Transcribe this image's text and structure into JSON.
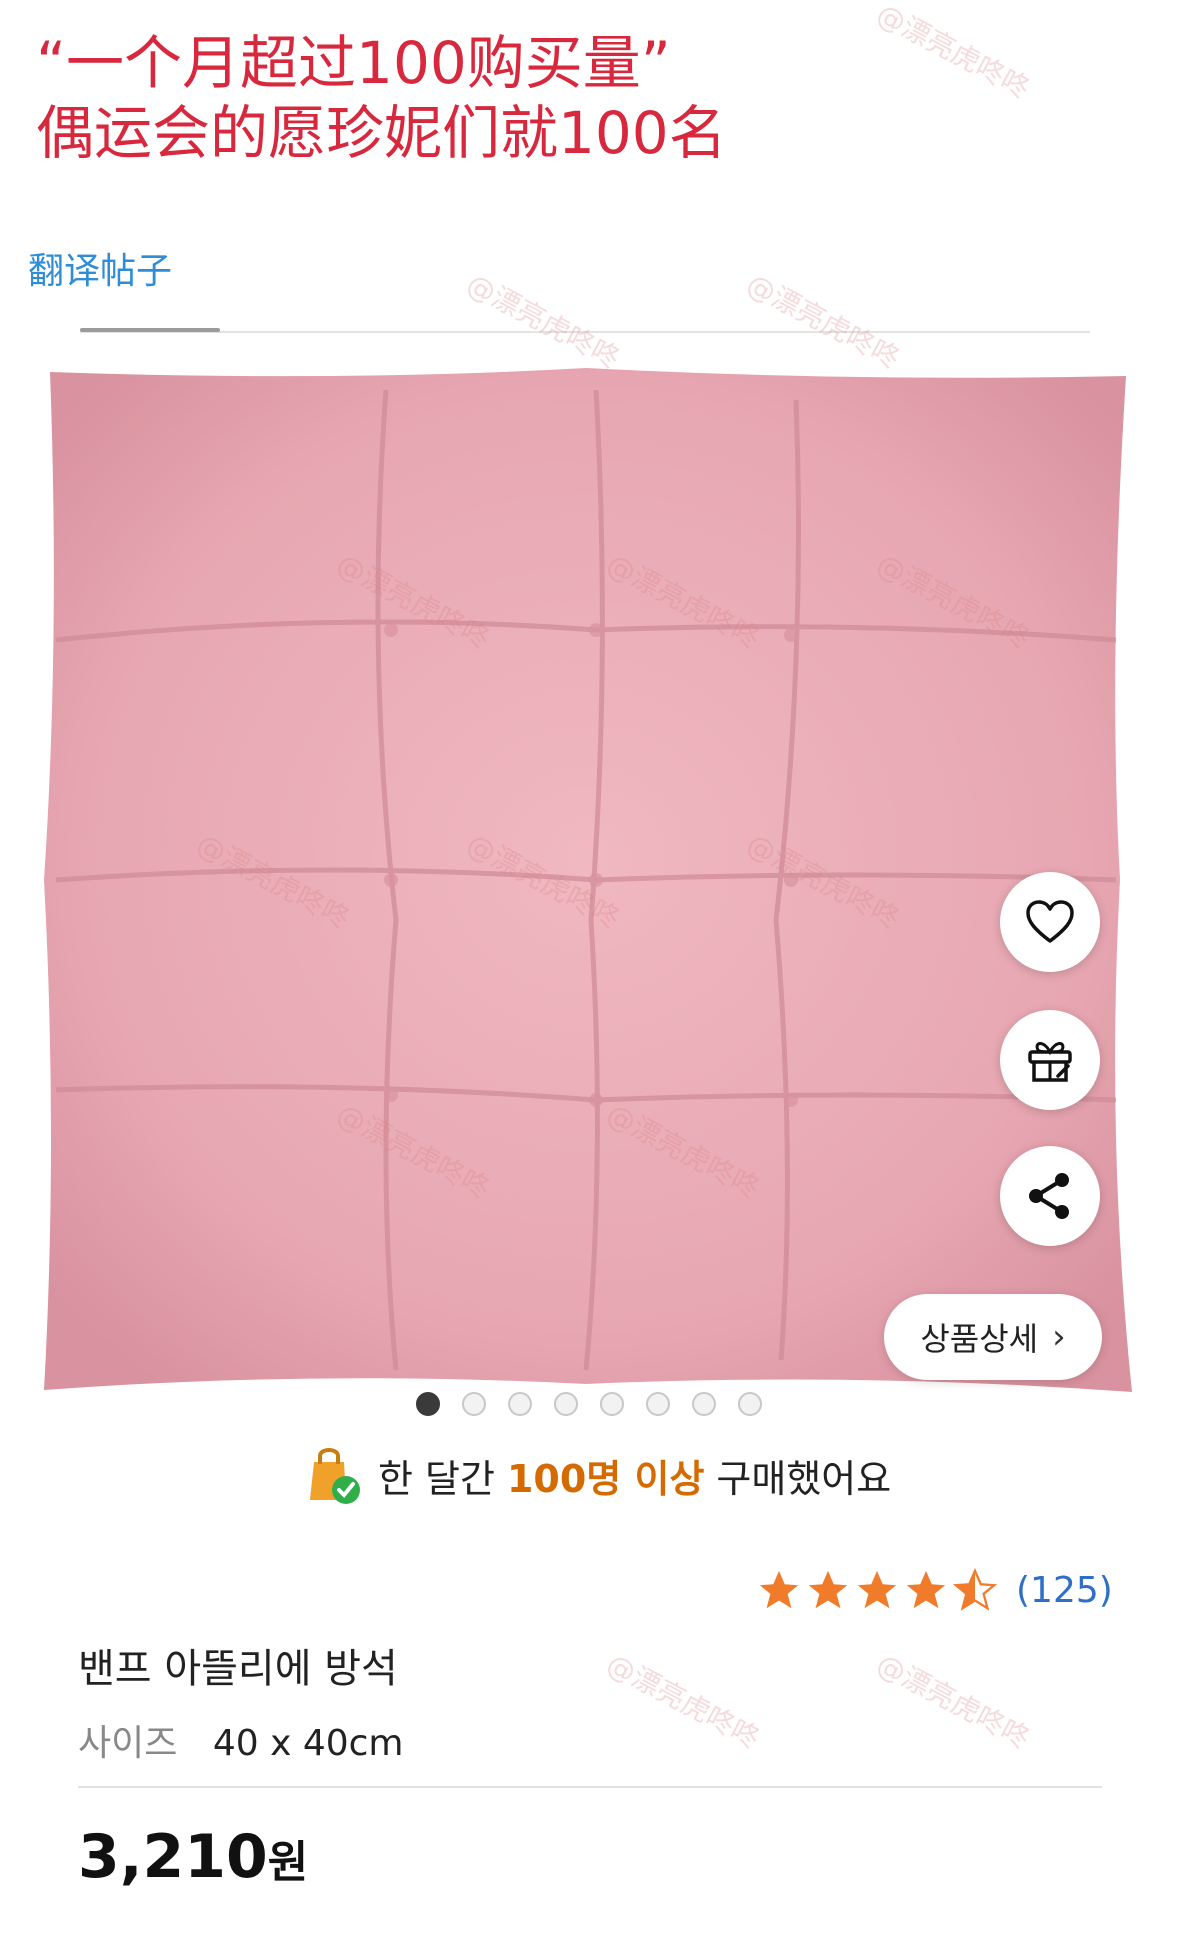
{
  "headline": {
    "line1": "“一个月超过100购买量”",
    "line2": "偶运会的愿珍妮们就100名"
  },
  "translate_link": "翻译帖子",
  "product_image": {
    "description_icon": "pink-seat-cushion",
    "dominant_color": "#e9aab5",
    "page_count": 8,
    "active_page": 1
  },
  "actions": {
    "wish_icon": "heart-icon",
    "gift_icon": "gift-icon",
    "share_icon": "share-icon",
    "detail_label": "상품상세",
    "detail_chevron": "›"
  },
  "purchase_banner": {
    "prefix": "한 달간",
    "highlight": "100명 이상",
    "suffix": "구매했어요",
    "highlight_color": "#d46a00"
  },
  "rating": {
    "stars": 4.5,
    "count_label": "(125)",
    "star_color": "#f07c2b"
  },
  "product": {
    "name": "밴프 아뜰리에 방석",
    "size_label": "사이즈",
    "size_value": "40 x 40cm",
    "price_value": "3,210",
    "price_unit": "원"
  },
  "watermark_text": "@漂亮虎咚咚"
}
